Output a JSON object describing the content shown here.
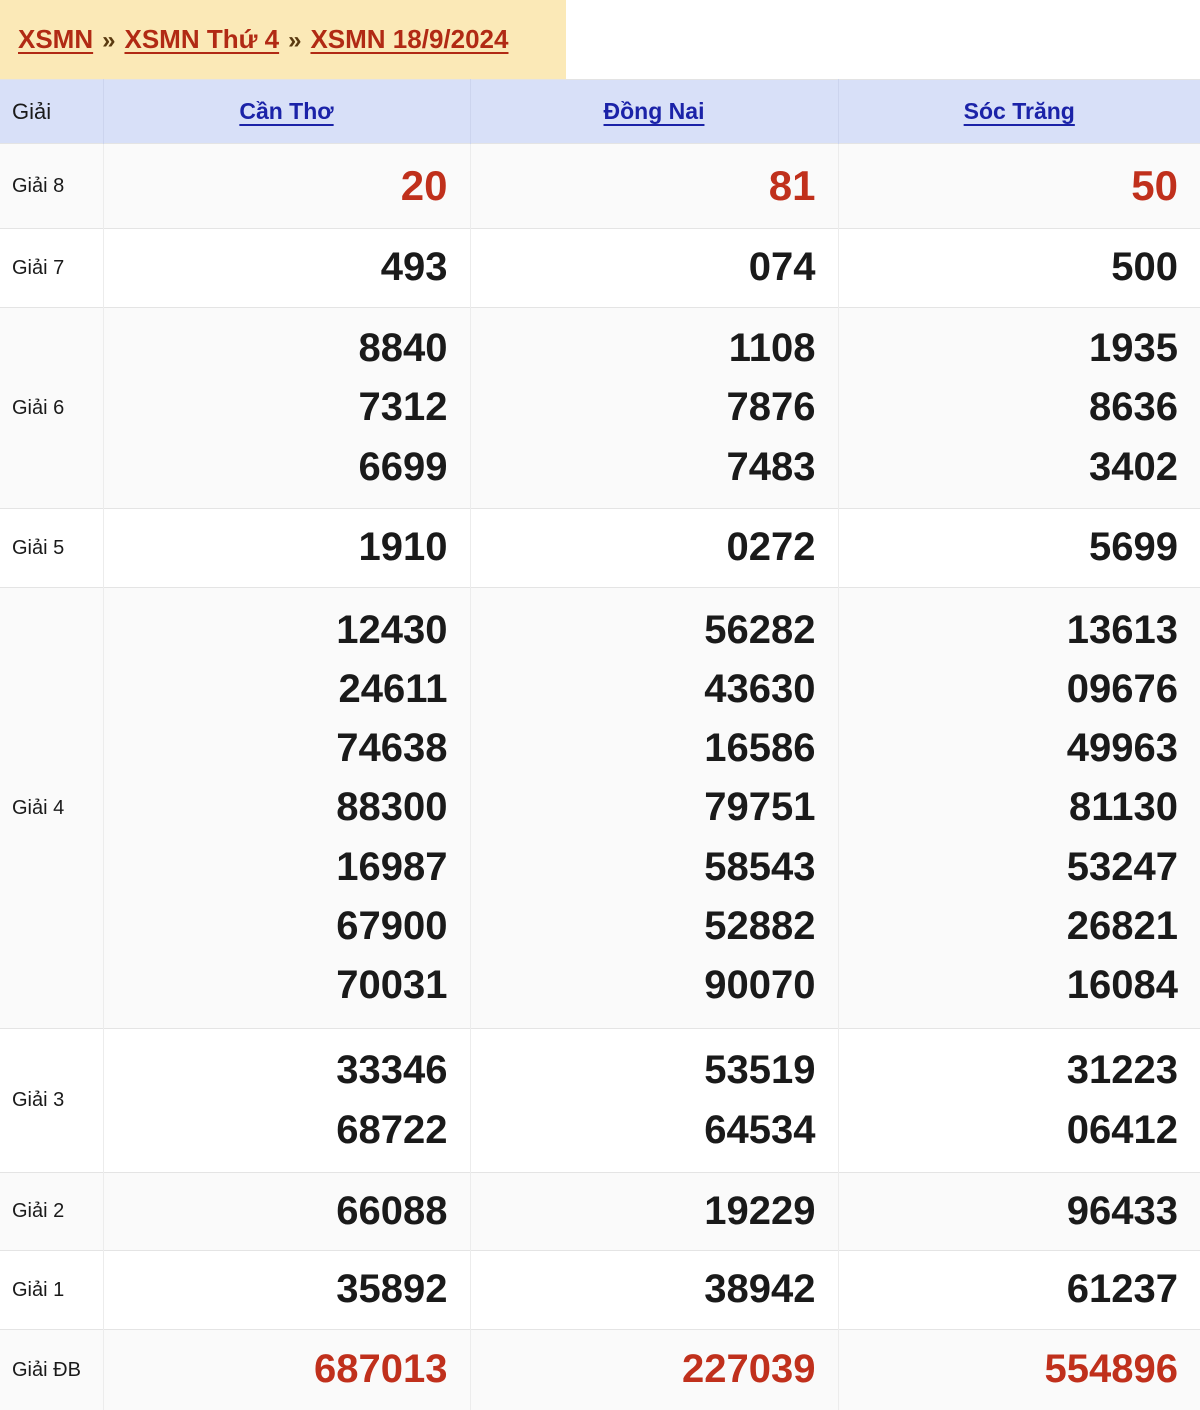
{
  "breadcrumb": {
    "separator": "»",
    "items": [
      {
        "label": "XSMN"
      },
      {
        "label": "XSMN Thứ 4"
      },
      {
        "label": "XSMN 18/9/2024"
      }
    ]
  },
  "colors": {
    "breadcrumb_bg": "#fbe9b7",
    "breadcrumb_link": "#b12a14",
    "header_bg": "#d8e0f8",
    "header_link": "#1b23a8",
    "highlight_number": "#c0301c",
    "number": "#1a1a1a",
    "row_alt_bg": "#fafafa",
    "border": "#e4e4e4"
  },
  "table": {
    "label_header": "Giải",
    "provinces": [
      {
        "name": "Cần Thơ"
      },
      {
        "name": "Đồng Nai"
      },
      {
        "name": "Sóc Trăng"
      }
    ],
    "rows": [
      {
        "label": "Giải 8",
        "style": "red-big",
        "values": [
          [
            "20"
          ],
          [
            "81"
          ],
          [
            "50"
          ]
        ]
      },
      {
        "label": "Giải 7",
        "style": "normal",
        "values": [
          [
            "493"
          ],
          [
            "074"
          ],
          [
            "500"
          ]
        ]
      },
      {
        "label": "Giải 6",
        "style": "normal",
        "values": [
          [
            "8840",
            "7312",
            "6699"
          ],
          [
            "1108",
            "7876",
            "7483"
          ],
          [
            "1935",
            "8636",
            "3402"
          ]
        ]
      },
      {
        "label": "Giải 5",
        "style": "normal",
        "values": [
          [
            "1910"
          ],
          [
            "0272"
          ],
          [
            "5699"
          ]
        ]
      },
      {
        "label": "Giải 4",
        "style": "normal",
        "values": [
          [
            "12430",
            "24611",
            "74638",
            "88300",
            "16987",
            "67900",
            "70031"
          ],
          [
            "56282",
            "43630",
            "16586",
            "79751",
            "58543",
            "52882",
            "90070"
          ],
          [
            "13613",
            "09676",
            "49963",
            "81130",
            "53247",
            "26821",
            "16084"
          ]
        ]
      },
      {
        "label": "Giải 3",
        "style": "normal",
        "values": [
          [
            "33346",
            "68722"
          ],
          [
            "53519",
            "64534"
          ],
          [
            "31223",
            "06412"
          ]
        ]
      },
      {
        "label": "Giải 2",
        "style": "normal",
        "values": [
          [
            "66088"
          ],
          [
            "19229"
          ],
          [
            "96433"
          ]
        ]
      },
      {
        "label": "Giải 1",
        "style": "normal",
        "values": [
          [
            "35892"
          ],
          [
            "38942"
          ],
          [
            "61237"
          ]
        ]
      },
      {
        "label": "Giải ĐB",
        "style": "red",
        "values": [
          [
            "687013"
          ],
          [
            "227039"
          ],
          [
            "554896"
          ]
        ]
      }
    ]
  }
}
